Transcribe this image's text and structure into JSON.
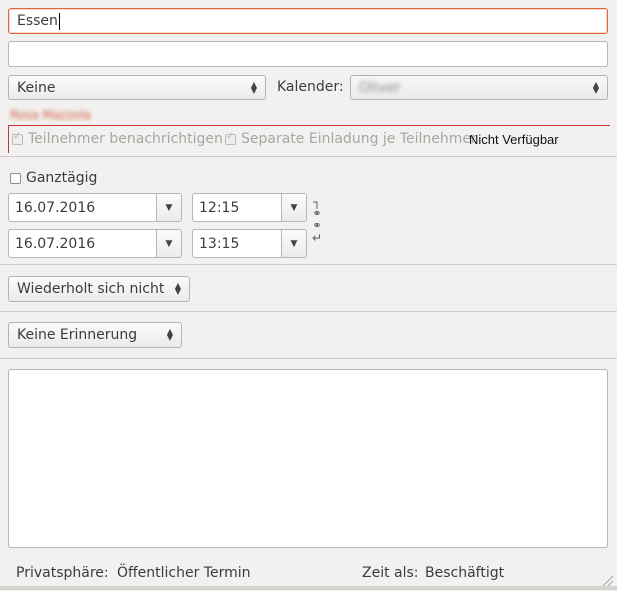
{
  "event": {
    "title_value": "Essen",
    "location_value": ""
  },
  "organizer": {
    "selected": "Keine",
    "calendar_label": "Kalender:",
    "calendar_value": "Oliver"
  },
  "attendees": {
    "blurred_name": "Rosa Mazzola",
    "notify_label": "Teilnehmer benachrichtigen",
    "separate_label": "Separate Einladung je Teilnehmer",
    "availability": "Nicht Verfügbar"
  },
  "timing": {
    "allday_label": "Ganztägig",
    "start_date": "16.07.2016",
    "start_time": "12:15",
    "end_date": "16.07.2016",
    "end_time": "13:15"
  },
  "recurrence": {
    "selected": "Wiederholt sich nicht"
  },
  "reminder": {
    "selected": "Keine Erinnerung"
  },
  "footer": {
    "privacy_label": "Privatsphäre:",
    "privacy_value": "Öffentlicher Termin",
    "show_as_label": "Zeit als:",
    "show_as_value": "Beschäftigt"
  },
  "icons": {
    "chain": "chain-link-icon",
    "dropdown": "chevron-down-icon",
    "spinner": "updown-arrows-icon"
  },
  "colors": {
    "accent": "#e0663c",
    "background": "#f2f1f0",
    "red_line": "#c5383a"
  }
}
